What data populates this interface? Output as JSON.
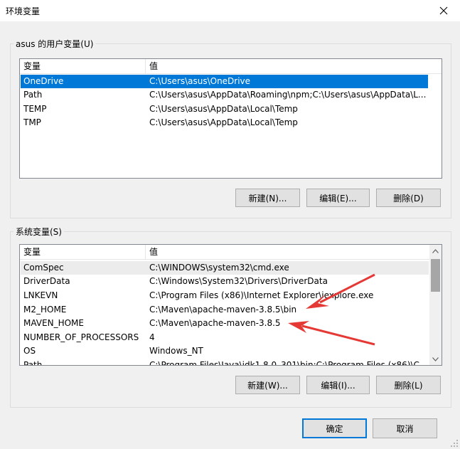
{
  "window": {
    "title": "环境变量",
    "close_icon": "close-icon"
  },
  "user_vars": {
    "group_label": "asus 的用户变量(U)",
    "columns": [
      "变量",
      "值"
    ],
    "rows": [
      {
        "name": "OneDrive",
        "value": "C:\\Users\\asus\\OneDrive",
        "selected": true
      },
      {
        "name": "Path",
        "value": "C:\\Users\\asus\\AppData\\Roaming\\npm;C:\\Users\\asus\\AppData\\L..."
      },
      {
        "name": "TEMP",
        "value": "C:\\Users\\asus\\AppData\\Local\\Temp"
      },
      {
        "name": "TMP",
        "value": "C:\\Users\\asus\\AppData\\Local\\Temp"
      }
    ],
    "buttons": {
      "new": "新建(N)...",
      "edit": "编辑(E)...",
      "delete": "删除(D)"
    }
  },
  "system_vars": {
    "group_label": "系统变量(S)",
    "columns": [
      "变量",
      "值"
    ],
    "rows": [
      {
        "name": "ComSpec",
        "value": "C:\\WINDOWS\\system32\\cmd.exe",
        "hover": true
      },
      {
        "name": "DriverData",
        "value": "C:\\Windows\\System32\\Drivers\\DriverData"
      },
      {
        "name": "LNKEVN",
        "value": "C:\\Program Files (x86)\\Internet Explorer\\iexplore.exe"
      },
      {
        "name": "M2_HOME",
        "value": "C:\\Maven\\apache-maven-3.8.5\\bin"
      },
      {
        "name": "MAVEN_HOME",
        "value": "C:\\Maven\\apache-maven-3.8.5"
      },
      {
        "name": "NUMBER_OF_PROCESSORS",
        "value": "4"
      },
      {
        "name": "OS",
        "value": "Windows_NT"
      },
      {
        "name": "Path",
        "value": "C:\\Program Files\\Java\\jdk1.8.0_301\\bin;C:\\Program Files (x86)\\C..."
      }
    ],
    "buttons": {
      "new": "新建(W)...",
      "edit": "编辑(I)...",
      "delete": "删除(L)"
    }
  },
  "footer": {
    "ok": "确定",
    "cancel": "取消"
  },
  "colors": {
    "selection": "#0078d7",
    "annotation_arrow": "#e53935"
  }
}
